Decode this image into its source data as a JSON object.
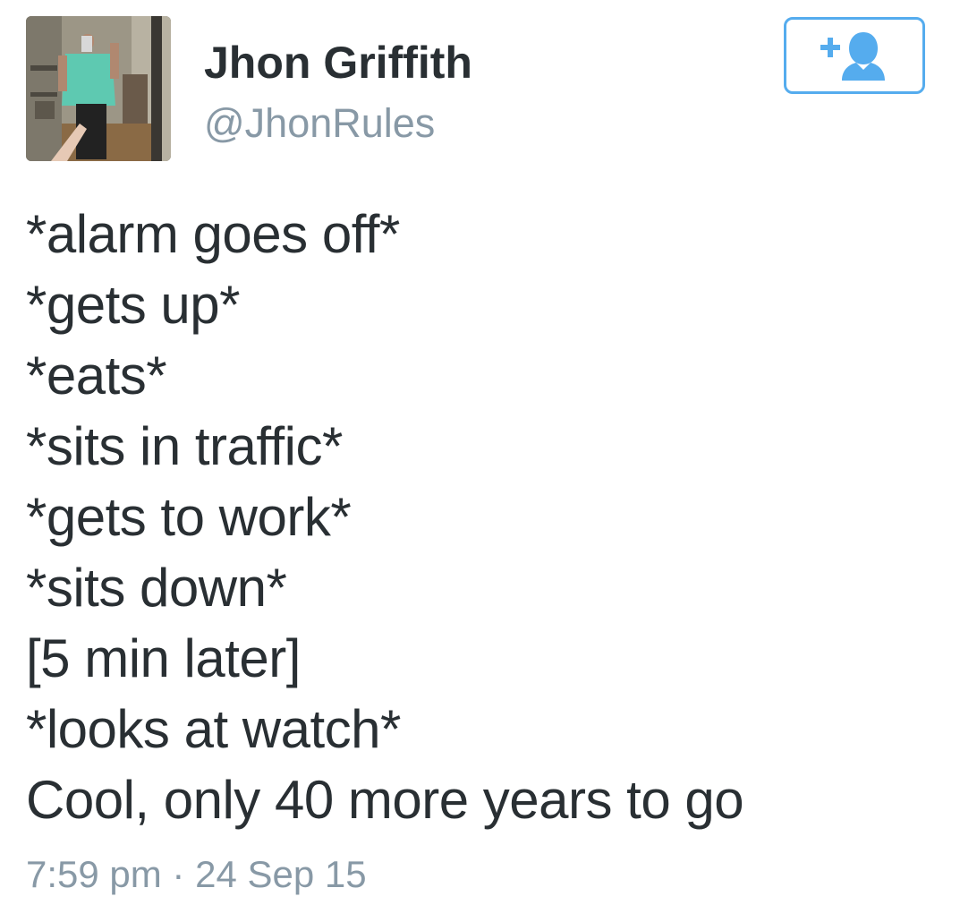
{
  "user": {
    "name": "Jhon Griffith",
    "handle": "@JhonRules"
  },
  "follow_button": {
    "icon": "add-user-icon",
    "color": "#55acee"
  },
  "tweet": {
    "lines": [
      "*alarm goes off*",
      "*gets up*",
      "*eats*",
      "*sits in traffic*",
      "*gets to work*",
      "*sits down*",
      "[5 min later]",
      "*looks at watch*",
      "Cool, only 40 more years to go"
    ],
    "timestamp": "7:59 pm · 24 Sep 15"
  },
  "colors": {
    "text": "#292f33",
    "secondary": "#8899a6",
    "accent": "#55acee"
  }
}
